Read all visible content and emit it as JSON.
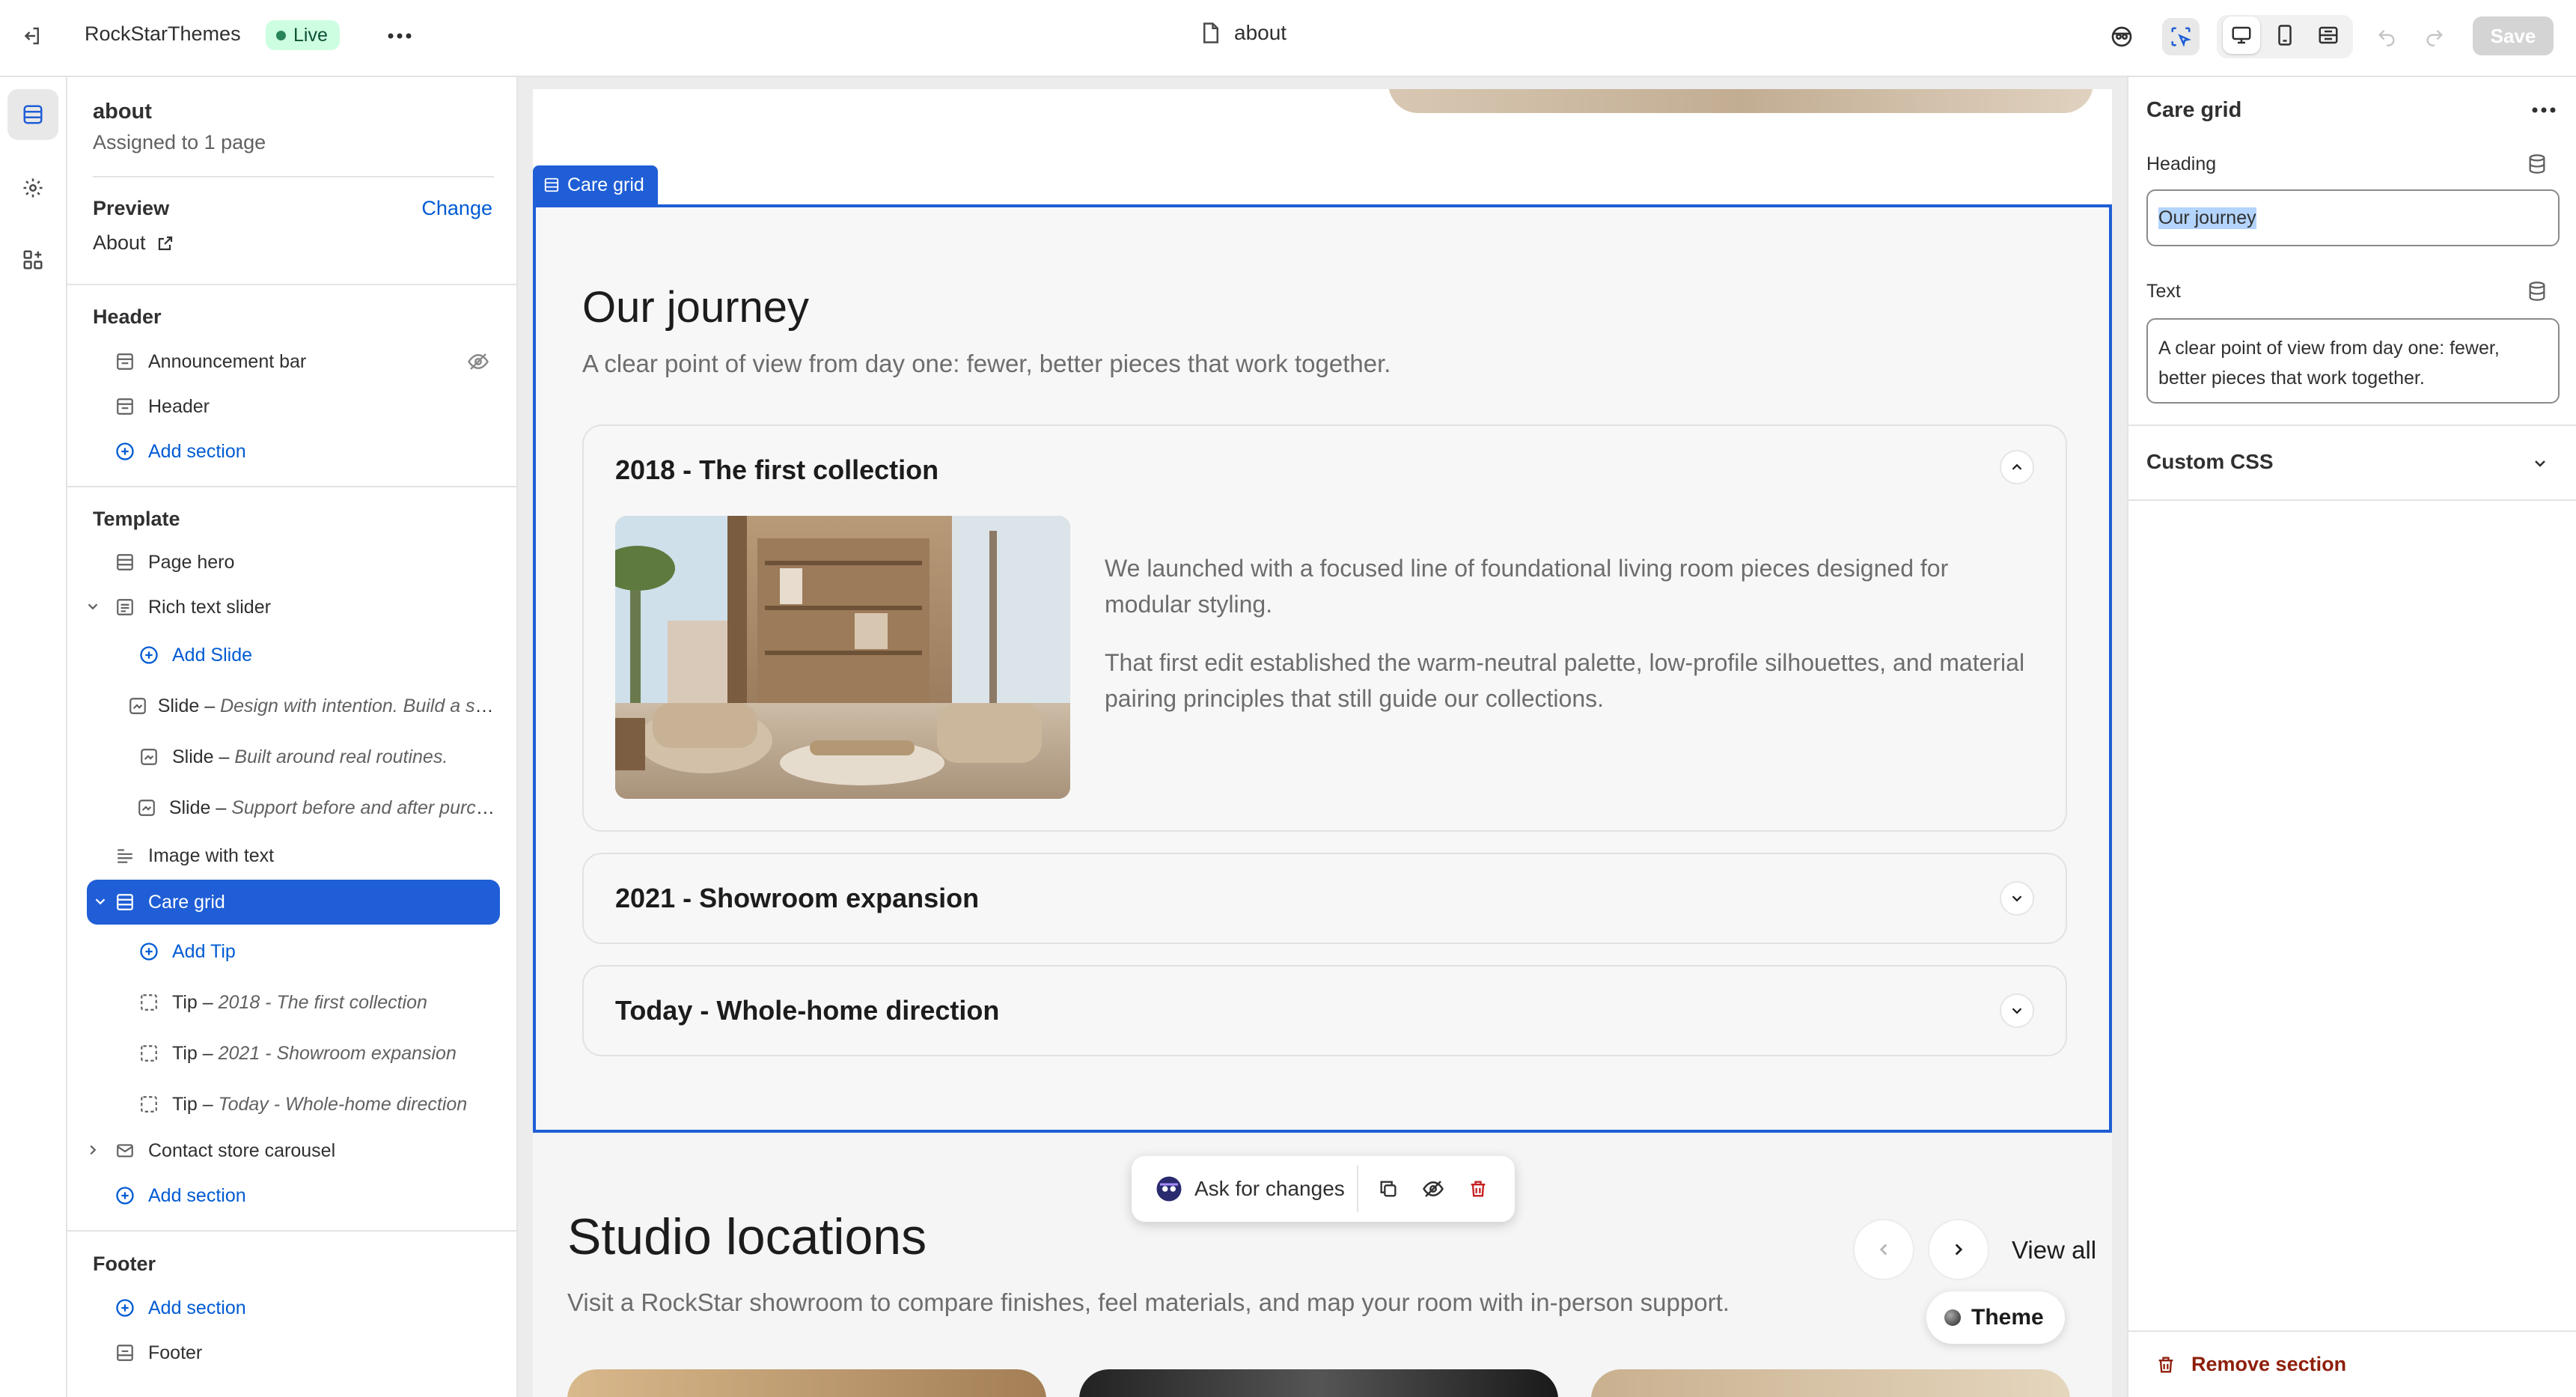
{
  "topbar": {
    "store_name": "RockStarThemes",
    "status": "Live",
    "page_name": "about",
    "save_label": "Save"
  },
  "sidebar": {
    "template_name": "about",
    "assigned": "Assigned to 1 page",
    "preview_label": "Preview",
    "change_label": "Change",
    "preview_page": "About",
    "header_group": "Header",
    "header_items": [
      "Announcement bar",
      "Header"
    ],
    "add_section": "Add section",
    "template_group": "Template",
    "page_hero": "Page hero",
    "rich_text_slider": "Rich text slider",
    "add_slide": "Add Slide",
    "slides": [
      {
        "kind": "Slide",
        "detail": "Design with intention. Build a space that feels like you."
      },
      {
        "kind": "Slide",
        "detail": "Built around real routines."
      },
      {
        "kind": "Slide",
        "detail": "Support before and after purchase."
      }
    ],
    "image_with_text": "Image with text",
    "care_grid": "Care grid",
    "add_tip": "Add Tip",
    "tips": [
      {
        "kind": "Tip",
        "detail": "2018 - The first collection"
      },
      {
        "kind": "Tip",
        "detail": "2021 - Showroom expansion"
      },
      {
        "kind": "Tip",
        "detail": "Today - Whole-home direction"
      }
    ],
    "contact_carousel": "Contact store carousel",
    "footer_group": "Footer",
    "footer_item": "Footer"
  },
  "canvas": {
    "section_tab": "Care grid",
    "heading": "Our journey",
    "text": "A clear point of view from day one: fewer, better pieces that work together.",
    "accordion": [
      {
        "title": "2018 - The first collection",
        "expanded": true,
        "paragraphs": [
          "We launched with a focused line of foundational living room pieces designed for modular styling.",
          "That first edit established the warm-neutral palette, low-profile silhouettes, and material pairing principles that still guide our collections."
        ]
      },
      {
        "title": "2021 - Showroom expansion",
        "expanded": false
      },
      {
        "title": "Today - Whole-home direction",
        "expanded": false
      }
    ],
    "studio_heading": "Studio locations",
    "studio_text": "Visit a RockStar showroom to compare finishes, feel materials, and map your room with in-person support.",
    "view_all": "View all",
    "ask_label": "Ask for changes",
    "theme_label": "Theme"
  },
  "panel": {
    "title": "Care grid",
    "heading_label": "Heading",
    "heading_value": "Our journey",
    "text_label": "Text",
    "text_value": "A clear point of view from day one: fewer, better pieces that work together.",
    "custom_css": "Custom CSS",
    "remove_section": "Remove section"
  },
  "colors": {
    "accent": "#1f5ed6",
    "link": "#005bd3",
    "live_bg": "#cdfee1",
    "remove": "#8e1f0b"
  }
}
